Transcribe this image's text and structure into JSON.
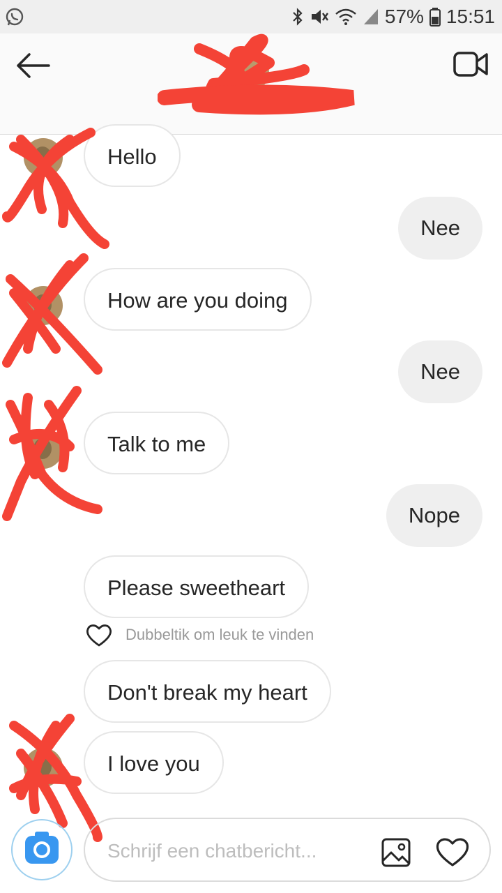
{
  "status_bar": {
    "battery": "57%",
    "time": "15:51"
  },
  "header": {
    "username": ""
  },
  "messages": [
    {
      "text": "Hello",
      "from": "them"
    },
    {
      "text": "Nee",
      "from": "me"
    },
    {
      "text": "How are you doing",
      "from": "them"
    },
    {
      "text": "Nee",
      "from": "me"
    },
    {
      "text": "Talk to me",
      "from": "them"
    },
    {
      "text": "Nope",
      "from": "me"
    },
    {
      "text": "Please sweetheart",
      "from": "them"
    },
    {
      "text": "Don't break my heart",
      "from": "them"
    },
    {
      "text": "I love you",
      "from": "them"
    }
  ],
  "like_hint": "Dubbeltik om leuk te vinden",
  "composer": {
    "placeholder": "Schrijf een chatbericht..."
  },
  "colors": {
    "accent": "#3897f0",
    "redaction": "#f44336",
    "outgoing_bubble": "#efefef",
    "incoming_border": "#e6e6e6"
  },
  "icons": [
    "whatsapp-icon",
    "bluetooth-icon",
    "mute-icon",
    "wifi-icon",
    "signal-icon",
    "battery-icon",
    "back-arrow-icon",
    "video-call-icon",
    "heart-icon",
    "camera-icon",
    "gallery-icon"
  ]
}
